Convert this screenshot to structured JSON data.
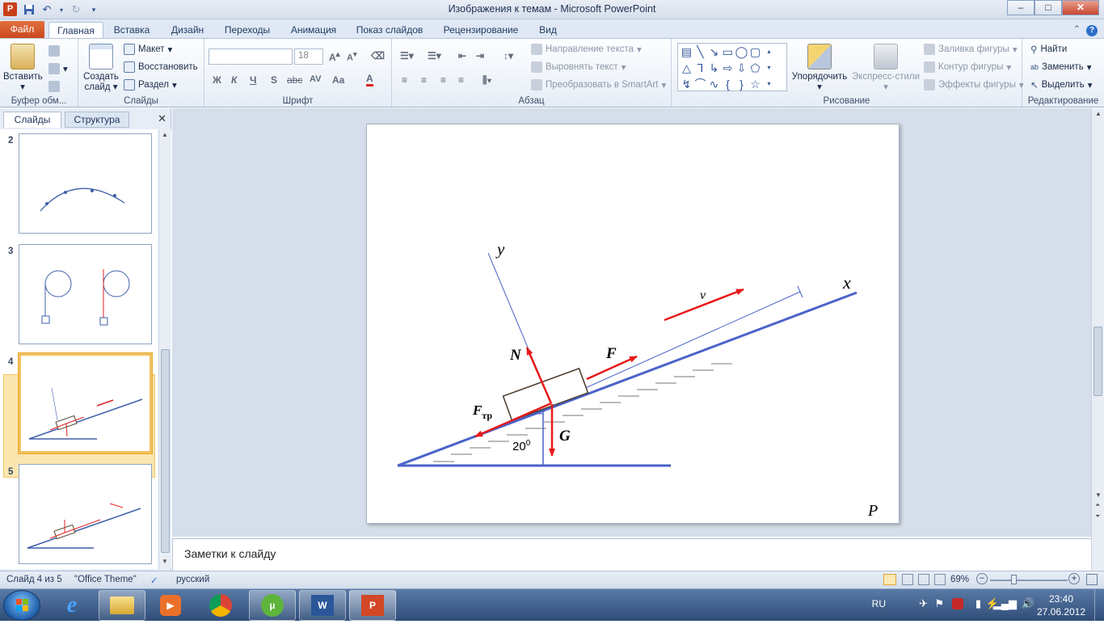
{
  "window": {
    "title": "Изображения к темам  -  Microsoft PowerPoint",
    "app_letter": "P",
    "min": "–",
    "max": "□",
    "close": "✕"
  },
  "tabs": {
    "file": "Файл",
    "items": [
      "Главная",
      "Вставка",
      "Дизайн",
      "Переходы",
      "Анимация",
      "Показ слайдов",
      "Рецензирование",
      "Вид"
    ]
  },
  "ribbon": {
    "clipboard": {
      "label": "Буфер обм...",
      "paste": "Вставить"
    },
    "slides": {
      "label": "Слайды",
      "new_slide_1": "Создать",
      "new_slide_2": "слайд",
      "layout": "Макет",
      "reset": "Восстановить",
      "section": "Раздел"
    },
    "font": {
      "label": "Шрифт",
      "font_name": "",
      "font_size": "18",
      "bold": "Ж",
      "italic": "К",
      "underline": "Ч",
      "shadow": "S",
      "strike": "abc",
      "spacing": "AV",
      "case": "Aa",
      "color": "A"
    },
    "paragraph": {
      "label": "Абзац",
      "text_direction": "Направление текста",
      "align_text": "Выровнять текст",
      "smartart": "Преобразовать в SmartArt"
    },
    "drawing": {
      "label": "Рисование",
      "arrange": "Упорядочить",
      "quick_styles": "Экспресс-стили",
      "shape_fill": "Заливка фигуры",
      "shape_outline": "Контур фигуры",
      "shape_effects": "Эффекты фигуры"
    },
    "editing": {
      "label": "Редактирование",
      "find": "Найти",
      "replace": "Заменить",
      "select": "Выделить"
    }
  },
  "side_pane": {
    "tab_slides": "Слайды",
    "tab_outline": "Структура",
    "close": "✕",
    "slide_numbers": [
      "2",
      "3",
      "4",
      "5"
    ],
    "selected": "4"
  },
  "slide": {
    "label_y": "y",
    "label_x": "x",
    "label_v": "v",
    "label_N": "N",
    "label_F": "F",
    "label_Ftr": "F",
    "label_Ftr_sub": "тр",
    "label_G": "G",
    "label_angle": "20",
    "label_angle_sup": "0",
    "label_P": "P",
    "line_color": "#4a63c9",
    "arrow_color": "#e8191a"
  },
  "notes": {
    "placeholder": "Заметки к слайду"
  },
  "status": {
    "slide_info": "Слайд 4 из 5",
    "theme": "\"Office Theme\"",
    "language": "русский",
    "zoom": "69%",
    "zoom_minus": "−",
    "zoom_plus": "+"
  },
  "taskbar": {
    "lang": "RU",
    "time": "23:40",
    "date": "27.06.2012"
  }
}
